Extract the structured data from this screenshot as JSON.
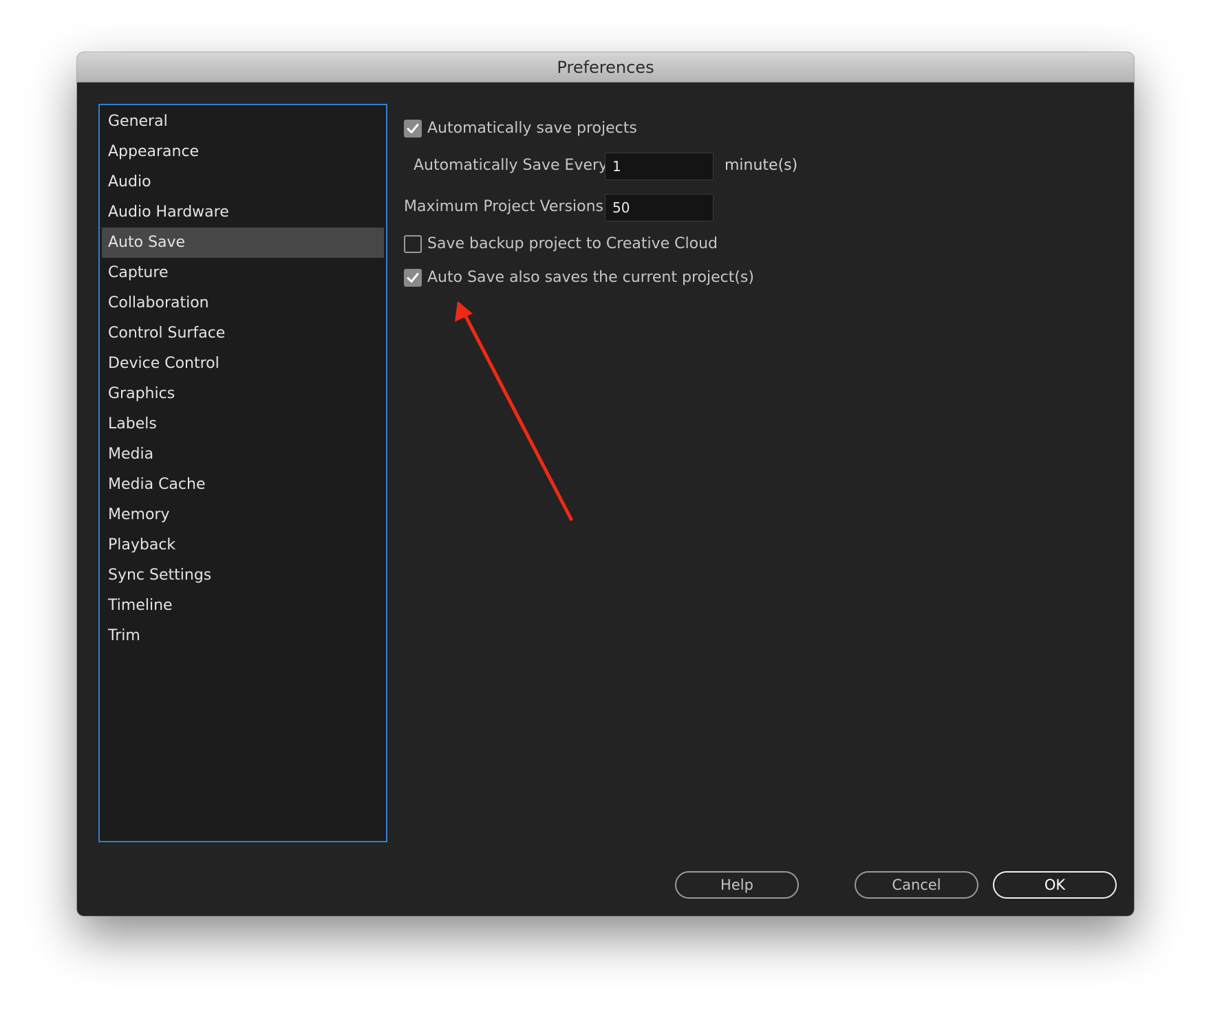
{
  "window": {
    "title": "Preferences"
  },
  "sidebar": {
    "selected_index": 4,
    "items": [
      {
        "label": "General"
      },
      {
        "label": "Appearance"
      },
      {
        "label": "Audio"
      },
      {
        "label": "Audio Hardware"
      },
      {
        "label": "Auto Save"
      },
      {
        "label": "Capture"
      },
      {
        "label": "Collaboration"
      },
      {
        "label": "Control Surface"
      },
      {
        "label": "Device Control"
      },
      {
        "label": "Graphics"
      },
      {
        "label": "Labels"
      },
      {
        "label": "Media"
      },
      {
        "label": "Media Cache"
      },
      {
        "label": "Memory"
      },
      {
        "label": "Playback"
      },
      {
        "label": "Sync Settings"
      },
      {
        "label": "Timeline"
      },
      {
        "label": "Trim"
      }
    ]
  },
  "autosave": {
    "auto_save_projects": {
      "label": "Automatically save projects",
      "checked": true
    },
    "save_every": {
      "label": "Automatically Save Every:",
      "value": "1",
      "unit": "minute(s)"
    },
    "max_versions": {
      "label": "Maximum Project Versions:",
      "value": "50"
    },
    "backup_creative_cloud": {
      "label": "Save backup project to Creative Cloud",
      "checked": false
    },
    "save_current_projects": {
      "label": "Auto Save also saves the current project(s)",
      "checked": true
    }
  },
  "buttons": {
    "help": "Help",
    "cancel": "Cancel",
    "ok": "OK"
  },
  "annotation": {
    "arrow_color": "#ee2a16"
  },
  "colors": {
    "selection_border": "#2f7fd3",
    "panel_background": "#232323"
  }
}
